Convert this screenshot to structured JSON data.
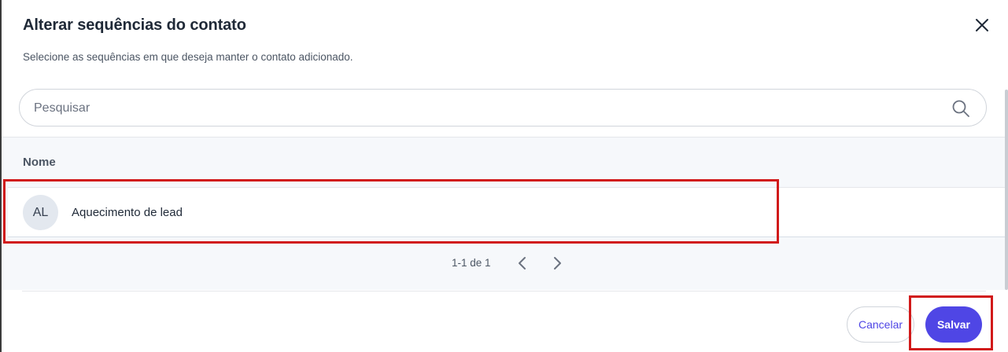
{
  "modal": {
    "title": "Alterar sequências do contato",
    "subtitle": "Selecione as sequências em que deseja manter o contato adicionado."
  },
  "search": {
    "placeholder": "Pesquisar",
    "value": ""
  },
  "table": {
    "columns": [
      "Nome"
    ],
    "rows": [
      {
        "initials": "AL",
        "name": "Aquecimento de lead"
      }
    ]
  },
  "pagination": {
    "text": "1-1 de 1"
  },
  "footer": {
    "cancel_label": "Cancelar",
    "save_label": "Salvar"
  },
  "colors": {
    "accent": "#4f46e5",
    "highlight": "#d11a1a"
  },
  "icons": [
    "close-icon",
    "search-icon",
    "chevron-left-icon",
    "chevron-right-icon"
  ]
}
